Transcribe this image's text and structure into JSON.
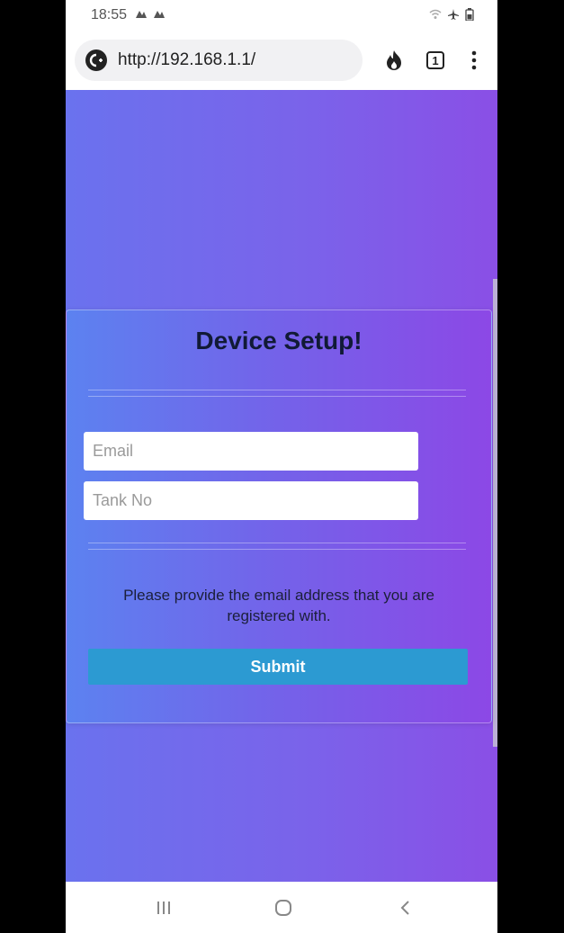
{
  "status_bar": {
    "time": "18:55",
    "left_icons": [
      "notification-icon",
      "notification-icon"
    ],
    "right_icons": [
      "wifi-icon",
      "airplane-icon",
      "battery-icon"
    ]
  },
  "browser": {
    "url": "http://192.168.1.1/",
    "tab_count": "1",
    "icons": [
      "site-info-icon",
      "flame-icon",
      "tabs-icon",
      "menu-icon"
    ]
  },
  "form": {
    "title": "Device Setup!",
    "email_placeholder": "Email",
    "tank_placeholder": "Tank No",
    "info_text": "Please provide the email address that you are registered with.",
    "submit_label": "Submit"
  },
  "colors": {
    "gradient_start": "#6a72ee",
    "gradient_end": "#8a4fe6",
    "button": "#2c9ad2"
  },
  "nav_bar": {
    "icons": [
      "recents-icon",
      "home-icon",
      "back-icon"
    ]
  }
}
